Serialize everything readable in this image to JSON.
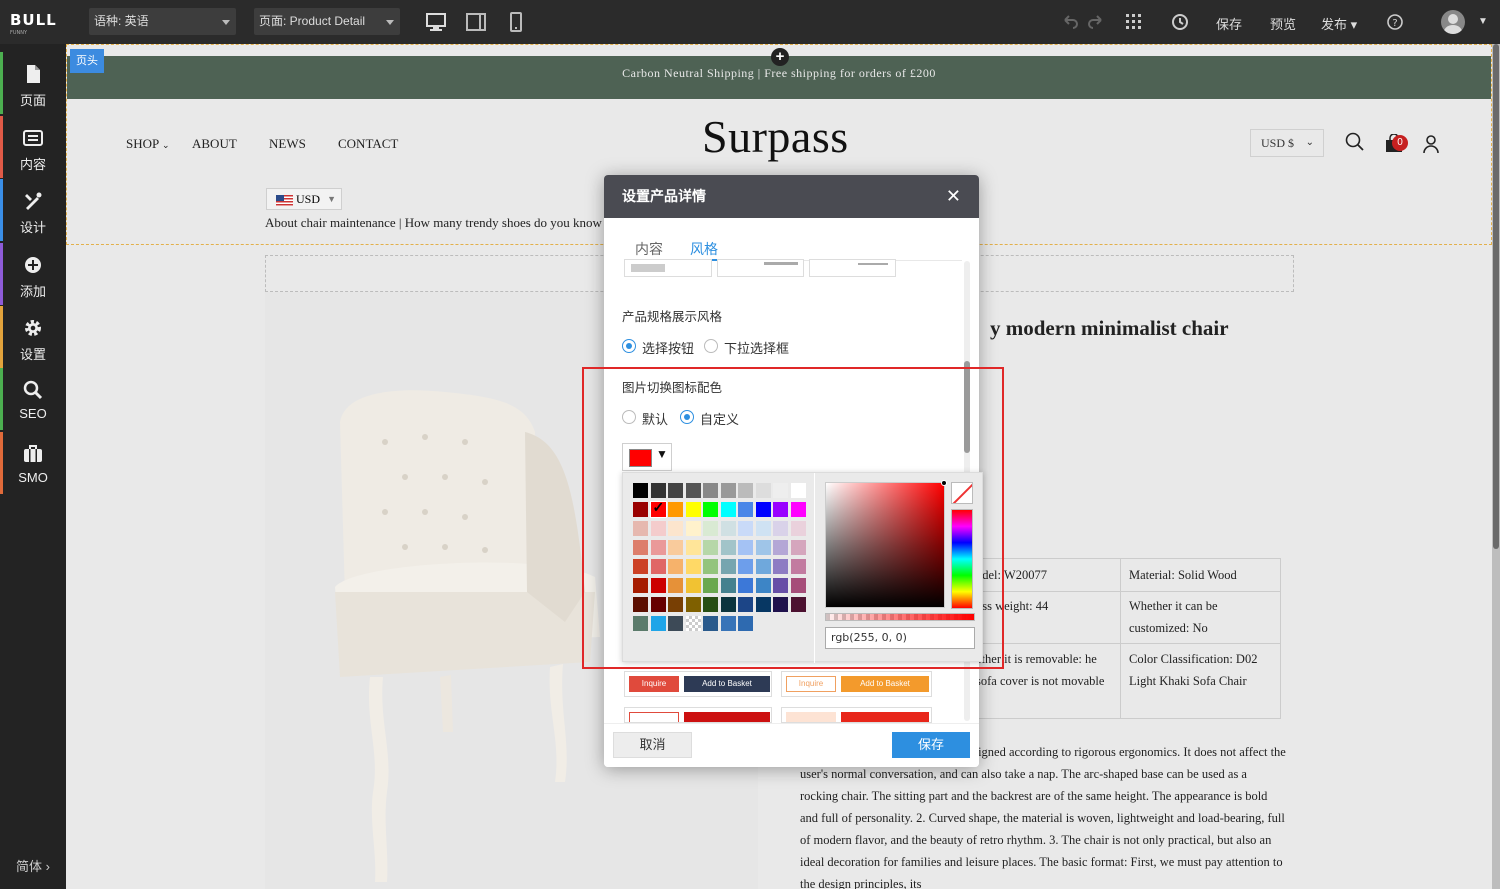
{
  "topbar": {
    "logo_main": "BULL",
    "logo_sub": "FUNNY",
    "language_label": "语种: 英语",
    "page_label": "页面: Product Detail",
    "save": "保存",
    "preview": "预览",
    "publish": "发布"
  },
  "sidebar": {
    "items": [
      {
        "label": "页面",
        "icon": "page-icon",
        "color": "#4caf50"
      },
      {
        "label": "内容",
        "icon": "content-icon",
        "color": "#e05a47"
      },
      {
        "label": "设计",
        "icon": "design-icon",
        "color": "#3a8ee6"
      },
      {
        "label": "添加",
        "icon": "add-icon",
        "color": "#8e5bd8"
      },
      {
        "label": "设置",
        "icon": "settings-icon",
        "color": "#e3a33c"
      },
      {
        "label": "SEO",
        "icon": "search-icon",
        "color": "#4caf50"
      },
      {
        "label": "SMO",
        "icon": "briefcase-icon",
        "color": "#e06a3a"
      }
    ],
    "language": "简体 ›"
  },
  "site": {
    "header_tag": "页头",
    "announcement": "Carbon Neutral Shipping | Free shipping for orders of £200",
    "nav": [
      "SHOP",
      "ABOUT",
      "NEWS",
      "CONTACT"
    ],
    "brand": "Surpass",
    "currency": "USD $",
    "cart_count": "0",
    "usd_selector": "USD",
    "blog_links": "About chair maintenance | How many trendy shoes do you know",
    "product_title": "y modern minimalist chair",
    "specs": [
      [
        "odel: W20077",
        "Material: Solid Wood"
      ],
      [
        "oss weight: 44",
        "Whether it can be customized: No"
      ],
      [
        "ether it is removable: he sofa cover is not movable",
        "Color Classification: D02 Light Khaki Sofa Chair"
      ]
    ],
    "description": "rve of the whole lounge chair is designed according to rigorous ergonomics. It does not affect the user's normal conversation, and can also take a nap. The arc-shaped base can be used as a rocking chair. The sitting part and the backrest are of the same height. The appearance is bold and full of personality. 2. Curved shape, the material is woven, lightweight and load-bearing, full of modern flavor, and the beauty of retro rhythm. 3. The chair is not only practical, but also an ideal decoration for families and leisure places. The basic format: First, we must pay attention to the design principles, its"
  },
  "dialog": {
    "title": "设置产品详情",
    "close": "✕",
    "tabs": [
      "内容",
      "风格"
    ],
    "active_tab": "风格",
    "spec_style_label": "产品规格展示风格",
    "spec_options": [
      "选择按钮",
      "下拉选择框"
    ],
    "icon_color_label": "图片切换图标配色",
    "color_options": [
      "默认",
      "自定义"
    ],
    "selected_color": "#ff0000",
    "rgb_value": "rgb(255, 0, 0)",
    "button_previews": [
      {
        "inquire": "Inquire",
        "basket": "Add to Basket"
      },
      {
        "inquire": "Inquire",
        "basket": "Add to Basket"
      }
    ],
    "cancel": "取消",
    "save": "保存"
  },
  "palette": [
    [
      "#000000",
      "#333333",
      "#444444",
      "#555555",
      "#888888",
      "#999999",
      "#bbbbbb",
      "#dddddd",
      "#eeeeee",
      "#ffffff"
    ],
    [
      "#990000",
      "#ff0000",
      "#ff9900",
      "#ffff00",
      "#00ff00",
      "#00ffff",
      "#4a86e8",
      "#0000ff",
      "#9900ff",
      "#ff00ff"
    ],
    [
      "#e6b8af",
      "#f4cccc",
      "#fce5cd",
      "#fff2cc",
      "#d9ead3",
      "#d0e0e3",
      "#c9daf8",
      "#cfe2f3",
      "#d9d2e9",
      "#ead1dc"
    ],
    [
      "#dd7e6b",
      "#ea9999",
      "#f9cb9c",
      "#ffe599",
      "#b6d7a8",
      "#a2c4c9",
      "#a4c2f4",
      "#9fc5e8",
      "#b4a7d6",
      "#d5a6bd"
    ],
    [
      "#cc4125",
      "#e06666",
      "#f6b26b",
      "#ffd966",
      "#93c47d",
      "#76a5af",
      "#6d9eeb",
      "#6fa8dc",
      "#8e7cc3",
      "#c27ba0"
    ],
    [
      "#a61c00",
      "#cc0000",
      "#e69138",
      "#f1c232",
      "#6aa84f",
      "#45818e",
      "#3c78d8",
      "#3d85c6",
      "#674ea7",
      "#a64d79"
    ],
    [
      "#5b0f00",
      "#660000",
      "#783f04",
      "#7f6000",
      "#274e13",
      "#0c343d",
      "#1c4587",
      "#073763",
      "#20124d",
      "#4c1130"
    ],
    [
      "#5b7b6b",
      "#1fa5e8",
      "#3d4a57",
      "checker",
      "#2a5a8c",
      "#3874b8",
      "#2e6ab0"
    ]
  ]
}
